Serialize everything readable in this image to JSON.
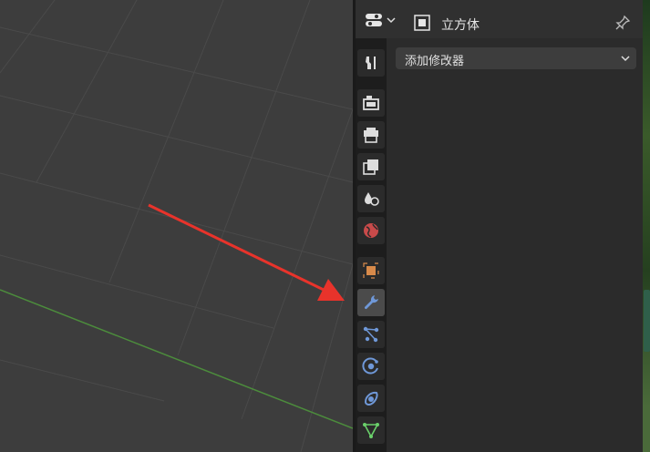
{
  "header": {
    "object_name": "立方体",
    "editor_icon": "properties-editor-icon",
    "object_icon": "object-data-icon",
    "pin_icon": "pin-icon"
  },
  "tabs": [
    {
      "icon": "tool-icon",
      "active": false
    },
    {
      "icon": "render-icon",
      "active": false
    },
    {
      "icon": "output-icon",
      "active": false
    },
    {
      "icon": "view-layer-icon",
      "active": false
    },
    {
      "icon": "scene-icon",
      "active": false
    },
    {
      "icon": "world-icon",
      "active": false
    },
    {
      "icon": "object-icon",
      "active": false
    },
    {
      "icon": "modifier-wrench-icon",
      "active": true
    },
    {
      "icon": "particles-icon",
      "active": false
    },
    {
      "icon": "physics-icon",
      "active": false
    },
    {
      "icon": "constraints-icon",
      "active": false
    },
    {
      "icon": "object-data-mesh-icon",
      "active": false
    }
  ],
  "modifier_panel": {
    "add_modifier_label": "添加修改器"
  },
  "annotation": {
    "arrow_color": "#e8332b",
    "points_to": "modifier-tab"
  },
  "colors": {
    "x_axis": "#4c8c3c",
    "active_tab": "#4b4b4b",
    "panel_bg": "#2b2b2b"
  }
}
